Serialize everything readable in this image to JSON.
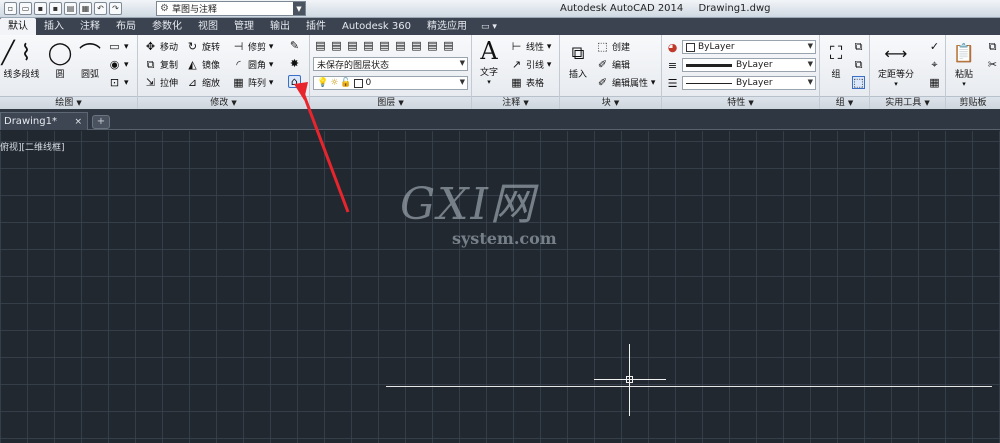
{
  "titlebar": {
    "workspace": "草图与注释",
    "app_name": "Autodesk AutoCAD 2014",
    "document": "Drawing1.dwg"
  },
  "tabs": [
    "默认",
    "插入",
    "注释",
    "布局",
    "参数化",
    "视图",
    "管理",
    "输出",
    "插件",
    "Autodesk 360",
    "精选应用"
  ],
  "draw_panel": {
    "title": "绘图",
    "tools": {
      "line": "线",
      "polyline": "多段线",
      "circle": "圆",
      "arc": "圆弧"
    }
  },
  "modify_panel": {
    "title": "修改",
    "tools": {
      "move": "移动",
      "rotate": "旋转",
      "trim": "修剪",
      "copy": "复制",
      "mirror": "镜像",
      "fillet": "圆角",
      "stretch": "拉伸",
      "scale": "缩放",
      "array": "阵列"
    }
  },
  "layers_panel": {
    "title": "图层",
    "layer_state": "未保存的图层状态",
    "current_layer": "0"
  },
  "annotation_panel": {
    "title": "注释",
    "text": "文字",
    "linear": "线性",
    "leader": "引线",
    "table": "表格"
  },
  "block_panel": {
    "title": "块",
    "insert": "插入",
    "create": "创建",
    "edit": "编辑",
    "edit_attributes": "编辑属性"
  },
  "properties_panel": {
    "title": "特性",
    "color": "ByLayer",
    "linetype": "ByLayer",
    "lineweight": "ByLayer"
  },
  "groups_panel": {
    "title": "组",
    "group": "组"
  },
  "utilities_panel": {
    "title": "实用工具",
    "measure": "定距等分"
  },
  "clipboard_panel": {
    "title": "剪贴板",
    "paste": "粘贴"
  },
  "file_tab": {
    "name": "Drawing1*",
    "close": "×"
  },
  "viewport": {
    "controls": "俯视][二维线框]"
  },
  "watermark": {
    "big": "GXI网",
    "sub": "system.com"
  }
}
